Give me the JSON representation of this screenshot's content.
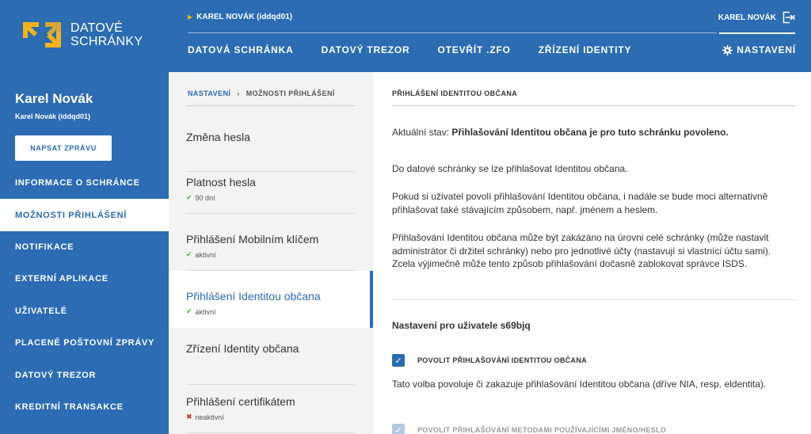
{
  "logo": {
    "line1": "DATOVÉ",
    "line2": "SCHRÁNKY",
    "icon": "arrows-logo-icon",
    "accent": "#f5b21c"
  },
  "header": {
    "current_box": "KAREL NOVÁK (iddqd01)",
    "user_name": "KAREL NOVÁK",
    "nav": [
      "DATOVÁ SCHRÁNKA",
      "DATOVÝ TREZOR",
      "OTEVŘÍT .ZFO",
      "ZŘÍZENÍ IDENTITY"
    ],
    "settings_label": "NASTAVENÍ"
  },
  "sidebar": {
    "name": "Karel Novák",
    "sub": "Karel Novák (iddqd01)",
    "compose_label": "NAPSAT ZPRÁVU",
    "items": [
      {
        "label": "INFORMACE O SCHRÁNCE"
      },
      {
        "label": "MOŽNOSTI PŘIHLÁŠENÍ",
        "active": true
      },
      {
        "label": "NOTIFIKACE"
      },
      {
        "label": "EXTERNÍ APLIKACE"
      },
      {
        "label": "UŽIVATELÉ"
      },
      {
        "label": "PLACENÉ POŠTOVNÍ ZPRÁVY"
      },
      {
        "label": "DATOVÝ TREZOR"
      },
      {
        "label": "KREDITNÍ TRANSAKCE"
      }
    ]
  },
  "breadcrumb": {
    "root": "NASTAVENÍ",
    "current": "MOŽNOSTI PŘIHLÁŠENÍ"
  },
  "options": [
    {
      "title": "Změna hesla",
      "status": ""
    },
    {
      "title": "Platnost hesla",
      "status": "90 dní",
      "status_icon": "check"
    },
    {
      "title": "Přihlášení Mobilním klíčem",
      "status": "aktivní",
      "status_icon": "check"
    },
    {
      "title": "Přihlášení Identitou občana",
      "status": "aktivní",
      "status_icon": "check",
      "selected": true
    },
    {
      "title": "Zřízení Identity občana",
      "status": ""
    },
    {
      "title": "Přihlášení certifikátem",
      "status": "neaktivní",
      "status_icon": "cross"
    }
  ],
  "content": {
    "title": "PŘIHLÁŠENÍ IDENTITOU OBČANA",
    "state_prefix": "Aktuální stav: ",
    "state_bold": "Přihlašování Identitou občana je pro tuto schránku povoleno.",
    "p1": "Do datové schránky se lze přihlašovat Identitou občana.",
    "p2": "Pokud si uživatel povolí přihlašování Identitou občana, i nadále se bude moci alternativně přihlašovat také stávajícím způsobem, např. jménem a heslem.",
    "p3": "Přihlašování Identitou občana může být zakázáno na úrovni celé schránky (může nastavit administrátor či držitel schránky) nebo pro jednotlivé účty (nastavují si vlastníci účtu sami). Zcela výjimečně může tento způsob přihlašování dočasně zablokovat správce ISDS.",
    "user_heading": "Nastavení pro uživatele s69bjq",
    "cb1_label": "POVOLIT PŘIHLAŠOVÁNÍ IDENTITOU OBČANA",
    "cb1_checked": true,
    "cb1_desc": "Tato volba povoluje či zakazuje přihlašování Identitou občana (dříve NIA, resp. eldentita).",
    "cb2_label": "POVOLIT PŘIHLAŠOVÁNÍ METODAMI POUŽÍVAJÍCÍMI JMÉNO/HESLO",
    "cb2_checked": true
  }
}
